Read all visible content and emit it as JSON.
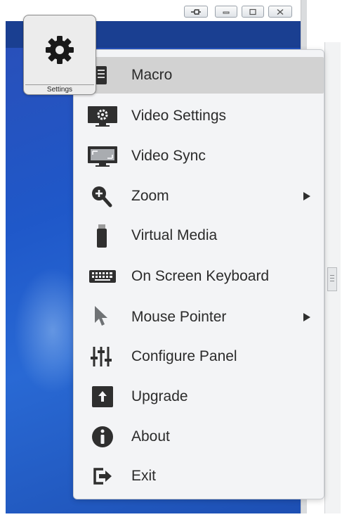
{
  "settings_button": {
    "label": "Settings",
    "icon": "gear-icon"
  },
  "menu": {
    "items": [
      {
        "label": "Macro",
        "icon": "macro-icon",
        "active": true,
        "submenu": false
      },
      {
        "label": "Video Settings",
        "icon": "monitor-gear-icon",
        "submenu": false
      },
      {
        "label": "Video Sync",
        "icon": "monitor-sync-icon",
        "submenu": false
      },
      {
        "label": "Zoom",
        "icon": "zoom-icon",
        "submenu": true
      },
      {
        "label": "Virtual Media",
        "icon": "usb-drive-icon",
        "submenu": false
      },
      {
        "label": "On Screen Keyboard",
        "icon": "keyboard-icon",
        "submenu": false
      },
      {
        "label": "Mouse Pointer",
        "icon": "mouse-pointer-icon",
        "submenu": true
      },
      {
        "label": "Configure Panel",
        "icon": "sliders-icon",
        "submenu": false
      },
      {
        "label": "Upgrade",
        "icon": "upgrade-icon",
        "submenu": false
      },
      {
        "label": "About",
        "icon": "info-icon",
        "submenu": false
      },
      {
        "label": "Exit",
        "icon": "exit-icon",
        "submenu": false
      }
    ]
  },
  "colors": {
    "desktop": "#1f58c9",
    "menu_bg": "#f3f4f6",
    "highlight": "#d2d2d2",
    "icon": "#2f2f2f"
  }
}
